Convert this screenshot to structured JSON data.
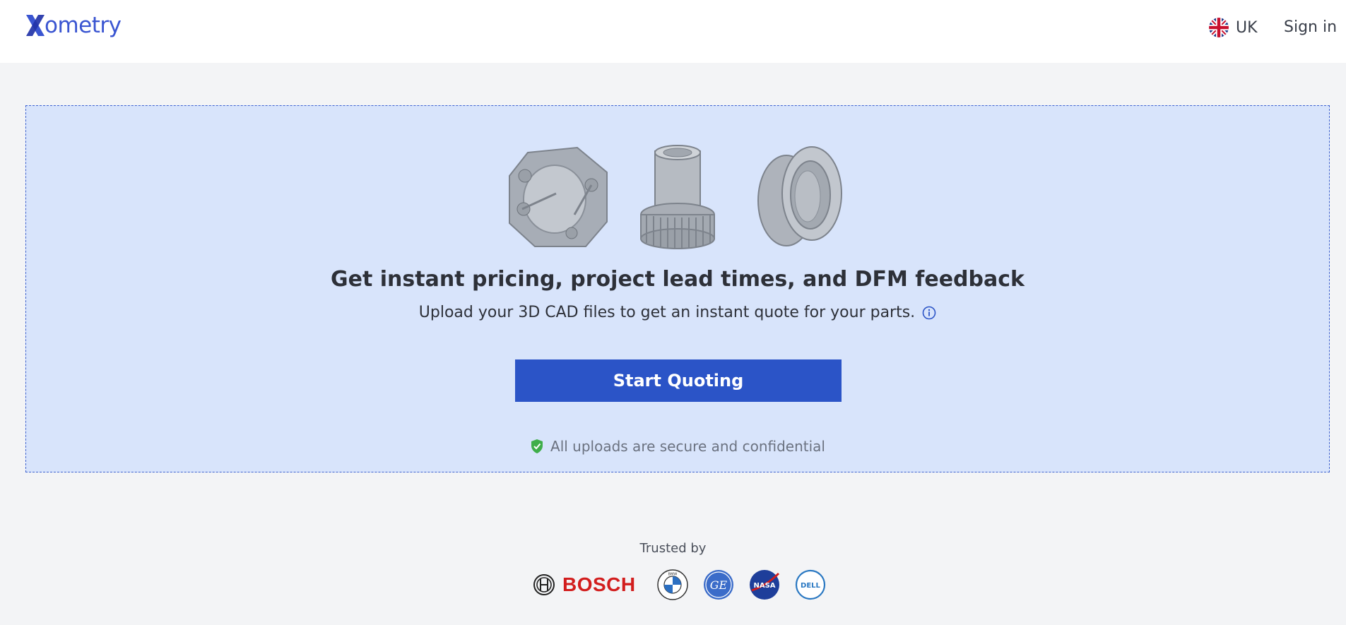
{
  "header": {
    "logo_text": "ometry",
    "logo_initial": "X",
    "region_label": "UK",
    "signin_label": "Sign in"
  },
  "upload": {
    "headline": "Get instant pricing, project lead times, and DFM feedback",
    "subline": "Upload your 3D CAD files to get an instant quote for your parts.",
    "cta_label": "Start Quoting",
    "secure_text": "All uploads are secure and confidential"
  },
  "trusted": {
    "label": "Trusted by",
    "brands": [
      {
        "name": "BOSCH",
        "icon": "bosch-logo"
      },
      {
        "name": "BMW",
        "icon": "bmw-logo"
      },
      {
        "name": "GE",
        "icon": "ge-logo"
      },
      {
        "name": "NASA",
        "icon": "nasa-logo"
      },
      {
        "name": "DELL",
        "icon": "dell-logo"
      }
    ]
  },
  "colors": {
    "brand": "#3a55d1",
    "cta": "#2b54c7",
    "dropzone_bg": "#d8e4fb",
    "page_bg": "#f3f4f6",
    "bosch_red": "#d21d1d"
  },
  "icons": {
    "flag": "uk-flag-icon",
    "info": "info-icon",
    "shield": "shield-check-icon"
  }
}
